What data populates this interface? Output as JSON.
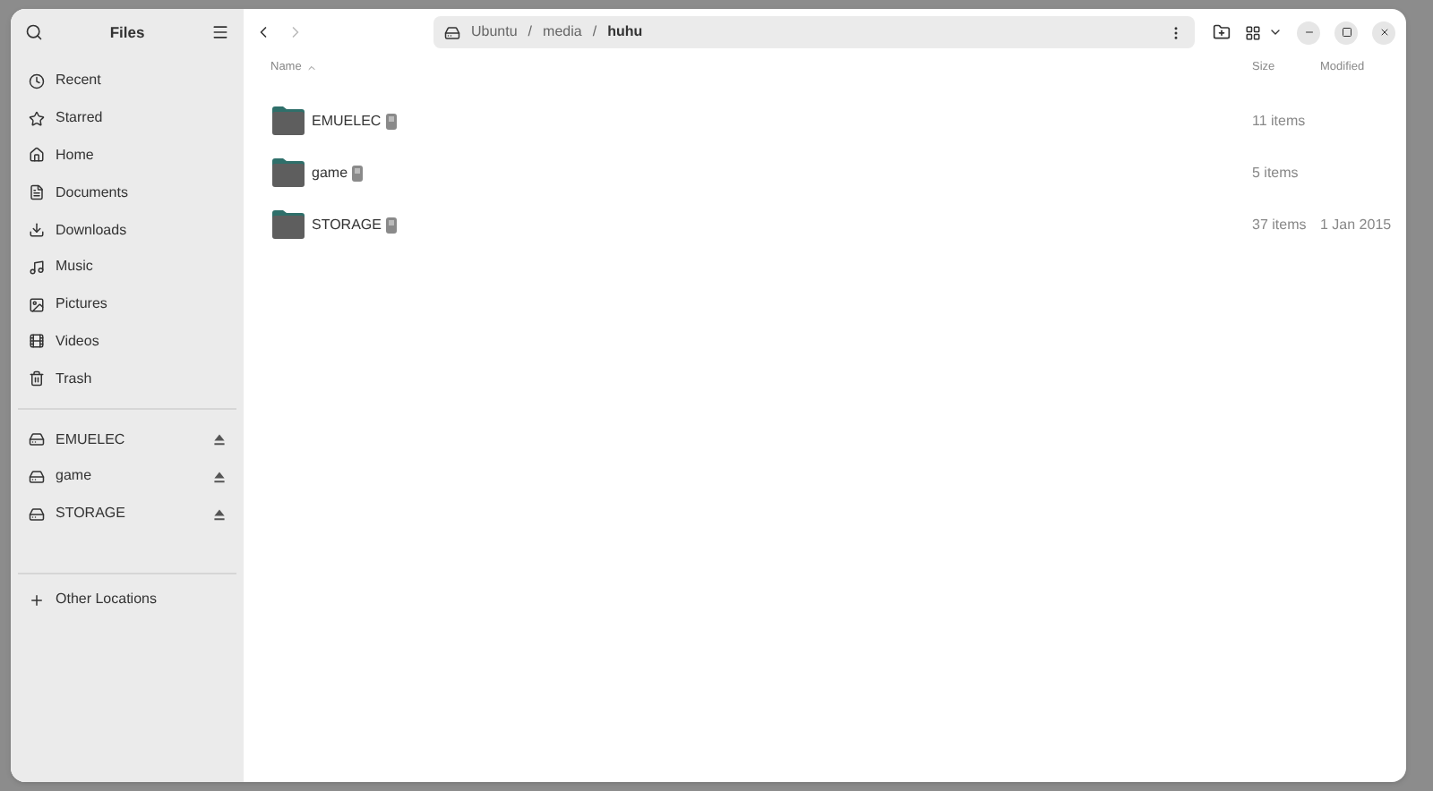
{
  "sidebar": {
    "title": "Files",
    "places": [
      {
        "label": "Recent",
        "selected": false
      },
      {
        "label": "Starred",
        "selected": false
      },
      {
        "label": "Home",
        "selected": false
      },
      {
        "label": "Documents",
        "selected": false
      },
      {
        "label": "Downloads",
        "selected": false
      },
      {
        "label": "Music",
        "selected": false
      },
      {
        "label": "Pictures",
        "selected": false
      },
      {
        "label": "Videos",
        "selected": false
      },
      {
        "label": "Trash",
        "selected": false
      }
    ],
    "devices": [
      {
        "label": "EMUELEC"
      },
      {
        "label": "game"
      },
      {
        "label": "STORAGE"
      }
    ],
    "other": "Other Locations"
  },
  "path": [
    "Ubuntu",
    "/",
    "media",
    "/",
    "huhu"
  ],
  "columns": {
    "name": "Name",
    "size": "Size",
    "modified": "Modified"
  },
  "rows": [
    {
      "name": "EMUELEC",
      "size": "11 items"
    },
    {
      "name": "game",
      "size": "5 items"
    },
    {
      "name": "STORAGE",
      "size": "37 items",
      "modified": "1 Jan 2015"
    }
  ]
}
